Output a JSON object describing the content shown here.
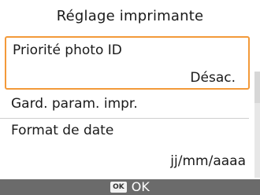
{
  "header": {
    "title": "Réglage imprimante"
  },
  "menu": {
    "items": [
      {
        "label": "Priorité photo ID",
        "value": "Désac."
      },
      {
        "label": "Gard. param. impr.",
        "value": ""
      },
      {
        "label": "Format de date",
        "value": "jj/mm/aaaa"
      }
    ]
  },
  "footer": {
    "button_badge": "OK",
    "button_label": "OK"
  },
  "colors": {
    "selection_border": "#f39a3a",
    "footer_bg": "#6b6b6b"
  }
}
